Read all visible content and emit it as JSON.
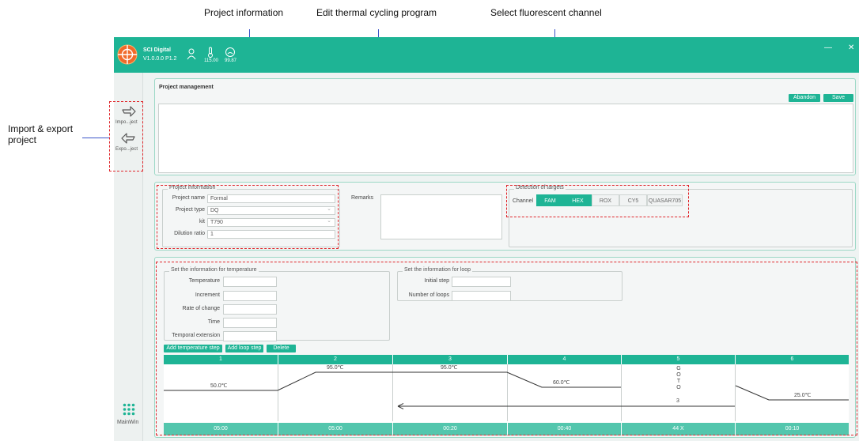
{
  "callouts": {
    "project_info": "Project information",
    "edit_program": "Edit thermal cycling program",
    "select_channel": "Select fluorescent channel",
    "import_export_line1": "Import & export",
    "import_export_line2": "project"
  },
  "app": {
    "name": "SCI Digital",
    "version": "V1.0.0.0 P1.2",
    "temp_readout": "115.00",
    "gauge_readout": "99.87",
    "min_glyph": "—",
    "close_glyph": "✕"
  },
  "sidebar": {
    "import_label": "Impo...ject",
    "export_label": "Expo...ject",
    "mainwin_label": "MainWin"
  },
  "project_mgmt": {
    "title": "Project management",
    "abandon": "Abandon",
    "save": "Save"
  },
  "project_info": {
    "group_title": "Project information",
    "name_label": "Project name",
    "name_value": "Formal",
    "type_label": "Project type",
    "type_value": "DQ",
    "kit_label": "kit",
    "kit_value": "T790",
    "dilution_label": "Dilution ratio",
    "dilution_value": "1",
    "remarks_label": "Remarks"
  },
  "detection": {
    "group_title": "Detection of targets",
    "channel_label": "Channel",
    "channels": [
      {
        "label": "FAM",
        "selected": true
      },
      {
        "label": "HEX",
        "selected": true
      },
      {
        "label": "ROX",
        "selected": false
      },
      {
        "label": "CY5",
        "selected": false
      },
      {
        "label": "QUASAR705",
        "selected": false
      }
    ]
  },
  "temperature_info": {
    "group_title": "Set the information for temperature",
    "temperature_label": "Temperature",
    "increment_label": "Increment",
    "rate_label": "Rate of change",
    "time_label": "Time",
    "extension_label": "Temporal extension"
  },
  "loop_info": {
    "group_title": "Set the information for loop",
    "initial_step_label": "Initial step",
    "num_loops_label": "Number of loops"
  },
  "program_buttons": {
    "add_temp_step": "Add temperature step",
    "add_loop_step": "Add loop step",
    "delete": "Delete"
  },
  "program": {
    "steps": [
      {
        "index": "1",
        "temp": "50.0℃",
        "time": "05:00"
      },
      {
        "index": "2",
        "temp": "95.0℃",
        "time": "05:00"
      },
      {
        "index": "3",
        "temp": "95.0℃",
        "time": "00:20"
      },
      {
        "index": "4",
        "temp": "60.0℃",
        "time": "00:40"
      },
      {
        "index": "5",
        "goto_letters": [
          "G",
          "O",
          "T",
          "O"
        ],
        "goto_step": "3",
        "time": "44 X"
      },
      {
        "index": "6",
        "temp": "25.0℃",
        "time": "00:10"
      }
    ]
  },
  "colors": {
    "accent": "#1eb495",
    "accent_light": "#53c6ad",
    "callout_line": "#3a55c8",
    "dashed_box": "#e0262b"
  }
}
